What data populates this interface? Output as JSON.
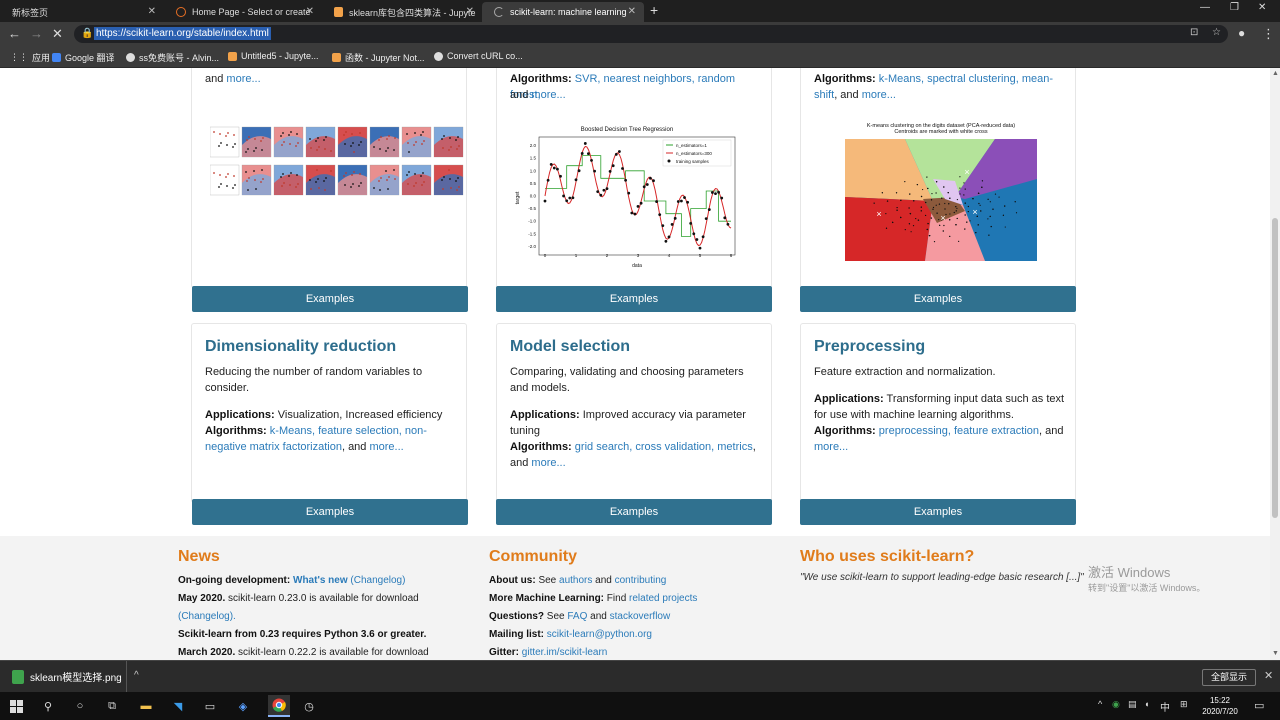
{
  "tabs": [
    {
      "label": "新标签页",
      "active": false
    },
    {
      "label": "Home Page - Select or create",
      "active": false
    },
    {
      "label": "sklearn库包含四类算法 - Jupyte",
      "active": false
    },
    {
      "label": "scikit-learn: machine learning",
      "active": true
    }
  ],
  "address": {
    "url": "https://scikit-learn.org/stable/index.html"
  },
  "bookmarks": [
    {
      "label": "应用",
      "icon": "apps-icon"
    },
    {
      "label": "Google 翻译",
      "icon": "google-translate-icon"
    },
    {
      "label": "ss免费账号 - Alvin...",
      "icon": "globe-icon"
    },
    {
      "label": "Untitled5 - Jupyte...",
      "icon": "jupyter-icon"
    },
    {
      "label": "函数 - Jupyter Not...",
      "icon": "jupyter-icon"
    },
    {
      "label": "Convert cURL co...",
      "icon": "globe-icon"
    }
  ],
  "top_cards": [
    {
      "tail_pre": "and ",
      "tail_link": "more...",
      "tail_post": ""
    },
    {
      "alg_label": "Algorithms:",
      "alg_links": "SVR, nearest neighbors, random forest,",
      "tail_pre": "and ",
      "tail_link": "more...",
      "tail_post": "",
      "chart_title": "Boosted Decision Tree Regression",
      "legend": [
        "n_estimators=1",
        "n_estimators=300",
        "training samples"
      ],
      "xlabel": "data",
      "ylabel": "target"
    },
    {
      "alg_label": "Algorithms:",
      "alg_links": "k-Means, spectral clustering, mean-",
      "tail_link_pre": "shift",
      "tail_pre": ", and ",
      "tail_link": "more...",
      "chart_title_1": "K-means clustering on the digits dataset (PCA-reduced data)",
      "chart_title_2": "Centroids are marked with white cross"
    }
  ],
  "examples_label": "Examples",
  "cards": [
    {
      "title": "Dimensionality reduction",
      "desc": "Reducing the number of random variables to consider.",
      "app_label": "Applications:",
      "app_text": "Visualization, Increased efficiency",
      "alg_label": "Algorithms:",
      "alg_links": "k-Means, feature selection, non-negative matrix factorization",
      "alg_post": ", and ",
      "more": "more..."
    },
    {
      "title": "Model selection",
      "desc": "Comparing, validating and choosing parameters and models.",
      "app_label": "Applications:",
      "app_text": "Improved accuracy via parameter tuning",
      "alg_label": "Algorithms:",
      "alg_links": "grid search, cross validation, metrics",
      "alg_post": ", and ",
      "more": "more..."
    },
    {
      "title": "Preprocessing",
      "desc": "Feature extraction and normalization.",
      "app_label": "Applications:",
      "app_text": "Transforming input data such as text for use with machine learning algorithms.",
      "alg_label": "Algorithms:",
      "alg_links": "preprocessing, feature extraction",
      "alg_post": ", and ",
      "more": "more..."
    }
  ],
  "news": {
    "title": "News",
    "l1_b": "On-going development:",
    "l1_link": "What's new",
    "l1_link2": "(Changelog)",
    "l2_b": "May 2020.",
    "l2_t": "scikit-learn 0.23.0 is available for download",
    "l2_link": "(Changelog).",
    "l3_b": "Scikit-learn from 0.23 requires Python 3.6 or greater.",
    "l4_b": "March 2020.",
    "l4_t": "scikit-learn 0.22.2 is available for download"
  },
  "community": {
    "title": "Community",
    "about_b": "About us:",
    "about_t": "See",
    "about_l1": "authors",
    "about_and": "and",
    "about_l2": "contributing",
    "more_b": "More Machine Learning:",
    "more_t": "Find",
    "more_l": "related projects",
    "q_b": "Questions?",
    "q_t": "See",
    "q_l1": "FAQ",
    "q_and": "and",
    "q_l2": "stackoverflow",
    "mail_b": "Mailing list:",
    "mail_l": "scikit-learn@python.org",
    "gitter_b": "Gitter:",
    "gitter_l": "gitter.im/scikit-learn"
  },
  "who": {
    "title": "Who uses scikit-learn?",
    "quote": "\"We use scikit-learn to support leading-edge basic research [...]\""
  },
  "watermark": {
    "line1": "激活 Windows",
    "line2": "转到\"设置\"以激活 Windows。"
  },
  "download": {
    "filename": "sklearn模型选择.png",
    "show_all": "全部显示"
  },
  "taskbar": {
    "time": "15:22",
    "date": "2020/7/20",
    "ime": "中"
  }
}
